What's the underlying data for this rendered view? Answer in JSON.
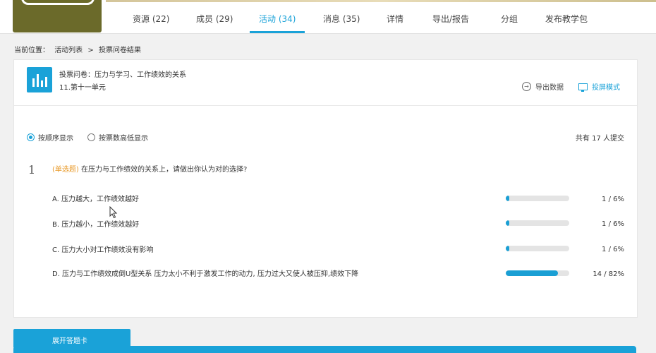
{
  "nav": {
    "tabs": [
      {
        "label": "资源 (22)"
      },
      {
        "label": "成员 (29)"
      },
      {
        "label": "活动 (34)"
      },
      {
        "label": "消息 (35)"
      },
      {
        "label": "详情"
      },
      {
        "label": "导出/报告"
      },
      {
        "label": "分组"
      },
      {
        "label": "发布教学包"
      }
    ],
    "accent": "#1aa2d8"
  },
  "breadcrumb": {
    "prefix": "当前位置：",
    "items": [
      "活动列表",
      ">",
      "投票问卷结果"
    ]
  },
  "poll": {
    "title": "投票问卷：压力与学习、工作绩效的关系",
    "subtitle": "11.第十一单元",
    "export_label": "导出数据",
    "projector_label": "投屏模式",
    "sort_options": [
      "按顺序显示",
      "按票数高低显示"
    ],
    "total_text": "共有 17 人提交"
  },
  "question": {
    "number": "1",
    "tag": "(单选题)",
    "text": "在压力与工作绩效的关系上，请做出你认为对的选择?",
    "options": [
      {
        "label": "A. 压力越大，工作绩效越好",
        "stat": "1 / 6%",
        "percent": 6
      },
      {
        "label": "B. 压力越小，工作绩效越好",
        "stat": "1 / 6%",
        "percent": 6
      },
      {
        "label": "C. 压力大小对工作绩效没有影响",
        "stat": "1 / 6%",
        "percent": 6
      },
      {
        "label": "D. 压力与工作绩效成倒U型关系 压力太小不利于激发工作的动力, 压力过大又使人被压抑,绩效下降",
        "stat": "14 / 82%",
        "percent": 82
      }
    ]
  },
  "footer": {
    "tab_label": "展开答题卡"
  }
}
